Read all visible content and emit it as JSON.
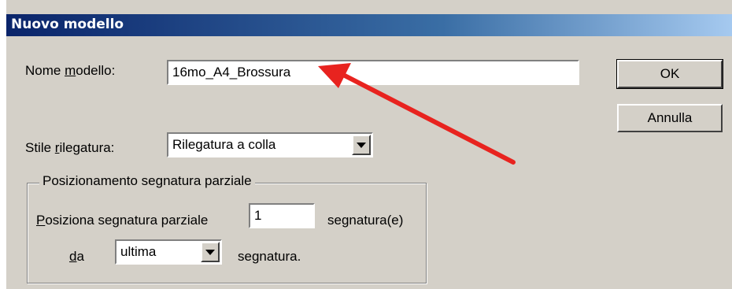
{
  "dialog": {
    "title": "Nuovo modello",
    "name_label_pre": "Nome ",
    "name_label_u": "m",
    "name_label_post": "odello:",
    "name_value": "16mo_A4_Brossura",
    "binding_label_pre": "Stile ",
    "binding_label_u": "r",
    "binding_label_post": "ilegatura:",
    "binding_value": "Rilegatura a colla",
    "ok_label": "OK",
    "cancel_label": "Annulla"
  },
  "group": {
    "legend": "Posizionamento segnatura parziale",
    "pos_label_u": "P",
    "pos_label_rest": "osiziona segnatura parziale",
    "pos_value": "1",
    "pos_unit": "segnatura(e)",
    "from_label_u": "d",
    "from_label_rest": "a",
    "from_value": "ultima",
    "from_suffix": "segnatura."
  },
  "colors": {
    "annotation_arrow": "#e8231f",
    "title_gradient_start": "#0a246a",
    "title_gradient_end": "#a6caf0"
  }
}
